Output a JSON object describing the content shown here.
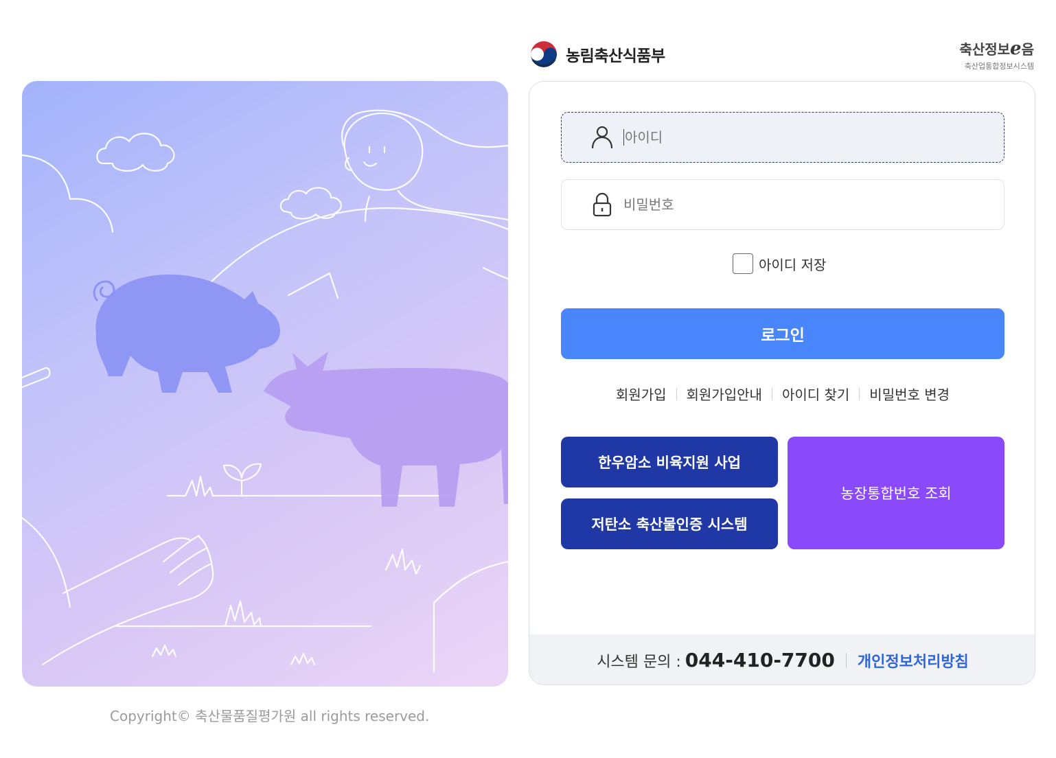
{
  "header": {
    "ministry_name": "농림축산식품부",
    "brand_title": "축산정보",
    "brand_e": "e",
    "brand_title_suffix": "음",
    "brand_subtitle": "축산업통합정보시스템"
  },
  "login": {
    "id_placeholder": "아이디",
    "password_placeholder": "비밀번호",
    "remember_id_label": "아이디 저장",
    "login_button": "로그인"
  },
  "links": {
    "signup": "회원가입",
    "signup_guide": "회원가입안내",
    "find_id": "아이디 찾기",
    "change_password": "비밀번호 변경"
  },
  "services": {
    "hanwoo": "한우암소 비육지원 사업",
    "low_carbon": "저탄소 축산물인증 시스템",
    "farm_number": "농장통합번호 조회"
  },
  "footer": {
    "inquiry_label": "시스템 문의 :",
    "phone": "044-410-7700",
    "privacy_policy": "개인정보처리방침"
  },
  "copyright": "Copyright© 축산물품질평가원 all rights reserved.",
  "colors": {
    "login_button": "#4a86fb",
    "service_blue": "#1f38a6",
    "service_purple": "#8a4afb",
    "privacy_link": "#3065d8"
  }
}
